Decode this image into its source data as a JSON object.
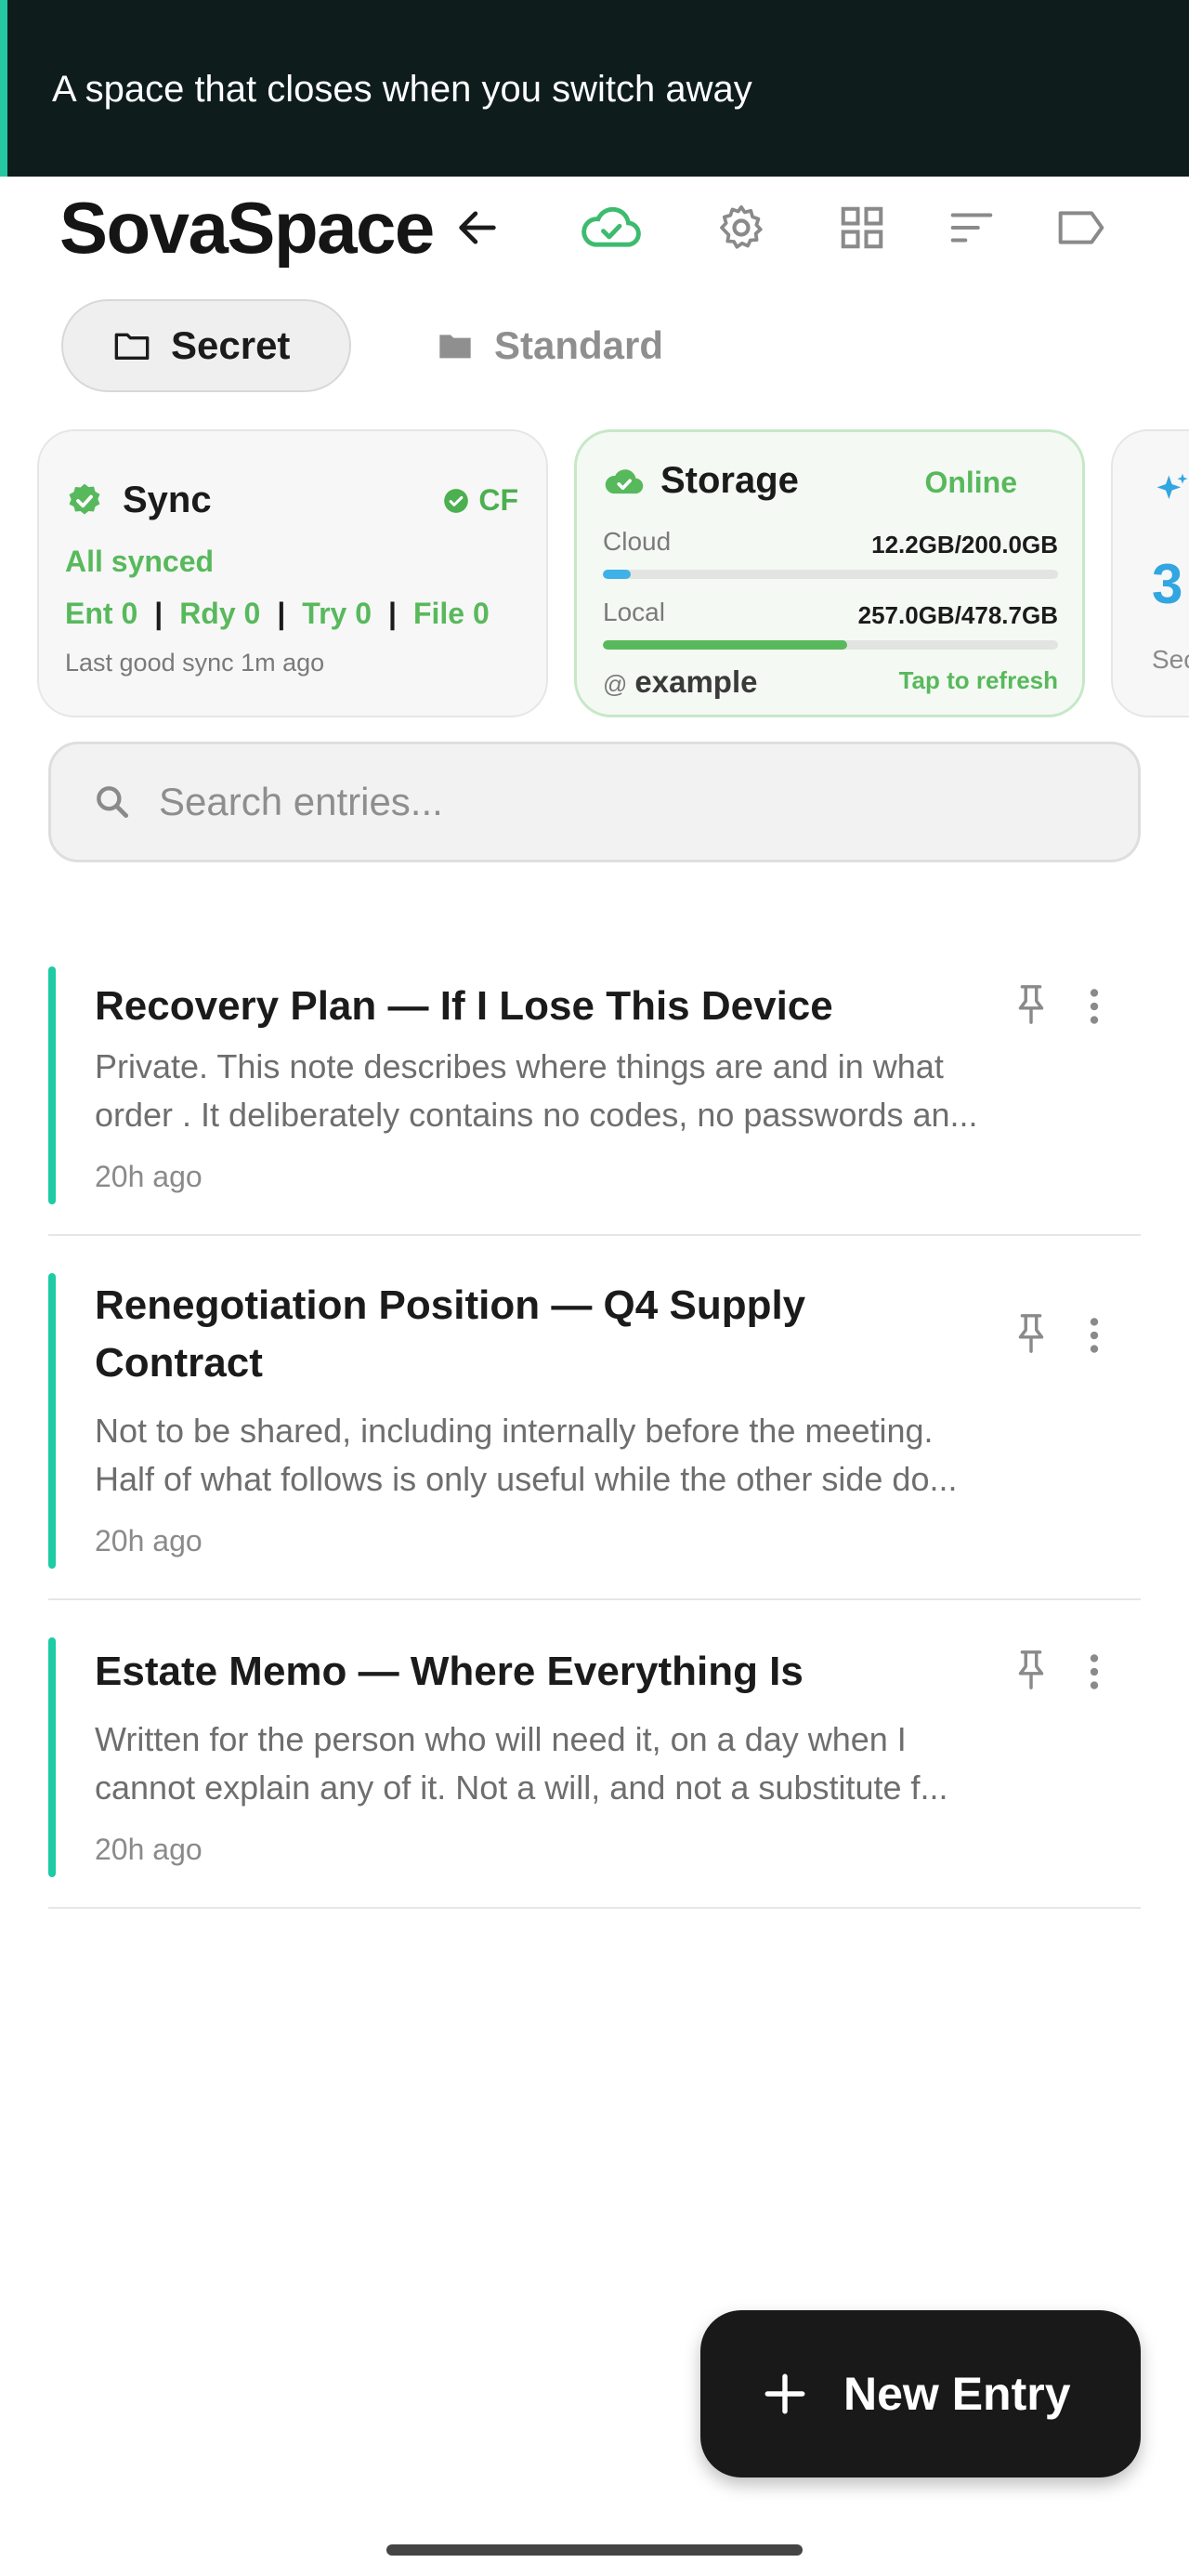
{
  "banner": {
    "text": "A space that closes when you switch away"
  },
  "header": {
    "logo": "SovaSpace",
    "icons": [
      "back-arrow-icon",
      "cloud-check-icon",
      "gear-icon",
      "grid-icon",
      "sort-icon",
      "label-icon"
    ],
    "accent_color": "#3dbb6f"
  },
  "tabs": [
    {
      "label": "Secret",
      "active": true
    },
    {
      "label": "Standard",
      "active": false
    }
  ],
  "sync_card": {
    "title": "Sync",
    "badge": "CF",
    "status": "All synced",
    "counts": [
      "Ent 0",
      "Rdy 0",
      "Try 0",
      "File 0"
    ],
    "last_sync": "Last good sync 1m ago"
  },
  "storage_card": {
    "title": "Storage",
    "status": "Online",
    "cloud_label": "Cloud",
    "cloud_value": "12.2GB/200.0GB",
    "cloud_fraction": 0.061,
    "local_label": "Local",
    "local_value": "257.0GB/478.7GB",
    "local_fraction": 0.537,
    "account": "example",
    "refresh_hint": "Tap to refresh",
    "cloud_color": "#3fb1e8",
    "local_color": "#58b95c"
  },
  "third_card": {
    "value": "3",
    "label": "Sec"
  },
  "search": {
    "placeholder": "Search entries..."
  },
  "entries": [
    {
      "title": "Recovery Plan — If I Lose This Device",
      "body1": "Private. This note describes where things are and in what",
      "body2": "order . It deliberately contains no codes, no passwords an...",
      "time": "20h ago"
    },
    {
      "title": "Renegotiation Position — Q4 Supply Contract",
      "body1": "Not to be shared, including internally before the meeting.",
      "body2": "Half of what follows is only useful while the other side do...",
      "time": "20h ago"
    },
    {
      "title": "Estate Memo — Where Everything Is",
      "body1": "Written for the person who will need it, on a day when I",
      "body2": "cannot explain any of it. Not a will, and not a substitute f...",
      "time": "20h ago"
    }
  ],
  "fab": {
    "label": "New Entry"
  }
}
